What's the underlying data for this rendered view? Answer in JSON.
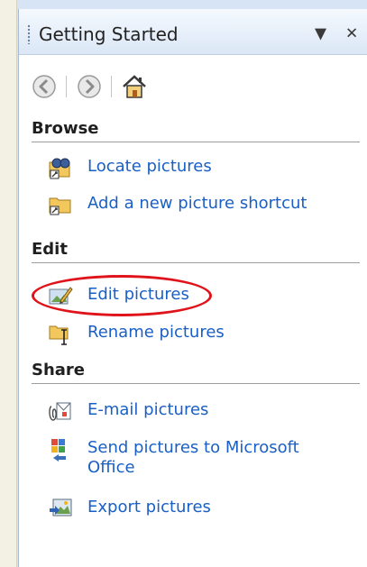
{
  "pane": {
    "title": "Getting Started",
    "dropdown_glyph": "▼",
    "close_glyph": "✕"
  },
  "toolbar": {
    "back_icon": "back-icon",
    "forward_icon": "forward-icon",
    "home_icon": "home-icon"
  },
  "sections": {
    "browse": {
      "heading": "Browse",
      "items": [
        {
          "label": "Locate pictures",
          "icon": "locate-pictures-icon"
        },
        {
          "label": "Add a new picture shortcut",
          "icon": "add-shortcut-icon"
        }
      ]
    },
    "edit": {
      "heading": "Edit",
      "items": [
        {
          "label": "Edit pictures",
          "icon": "edit-pictures-icon"
        },
        {
          "label": "Rename pictures",
          "icon": "rename-pictures-icon"
        }
      ]
    },
    "share": {
      "heading": "Share",
      "items": [
        {
          "label": "E-mail pictures",
          "icon": "email-pictures-icon"
        },
        {
          "label": "Send pictures to Microsoft Office",
          "icon": "send-to-office-icon"
        },
        {
          "label": "Export pictures",
          "icon": "export-pictures-icon"
        }
      ]
    }
  },
  "annotation": {
    "color": "#e0131b"
  },
  "colors": {
    "link": "#1a5fc5",
    "header_bg": "#dbe7f6"
  }
}
